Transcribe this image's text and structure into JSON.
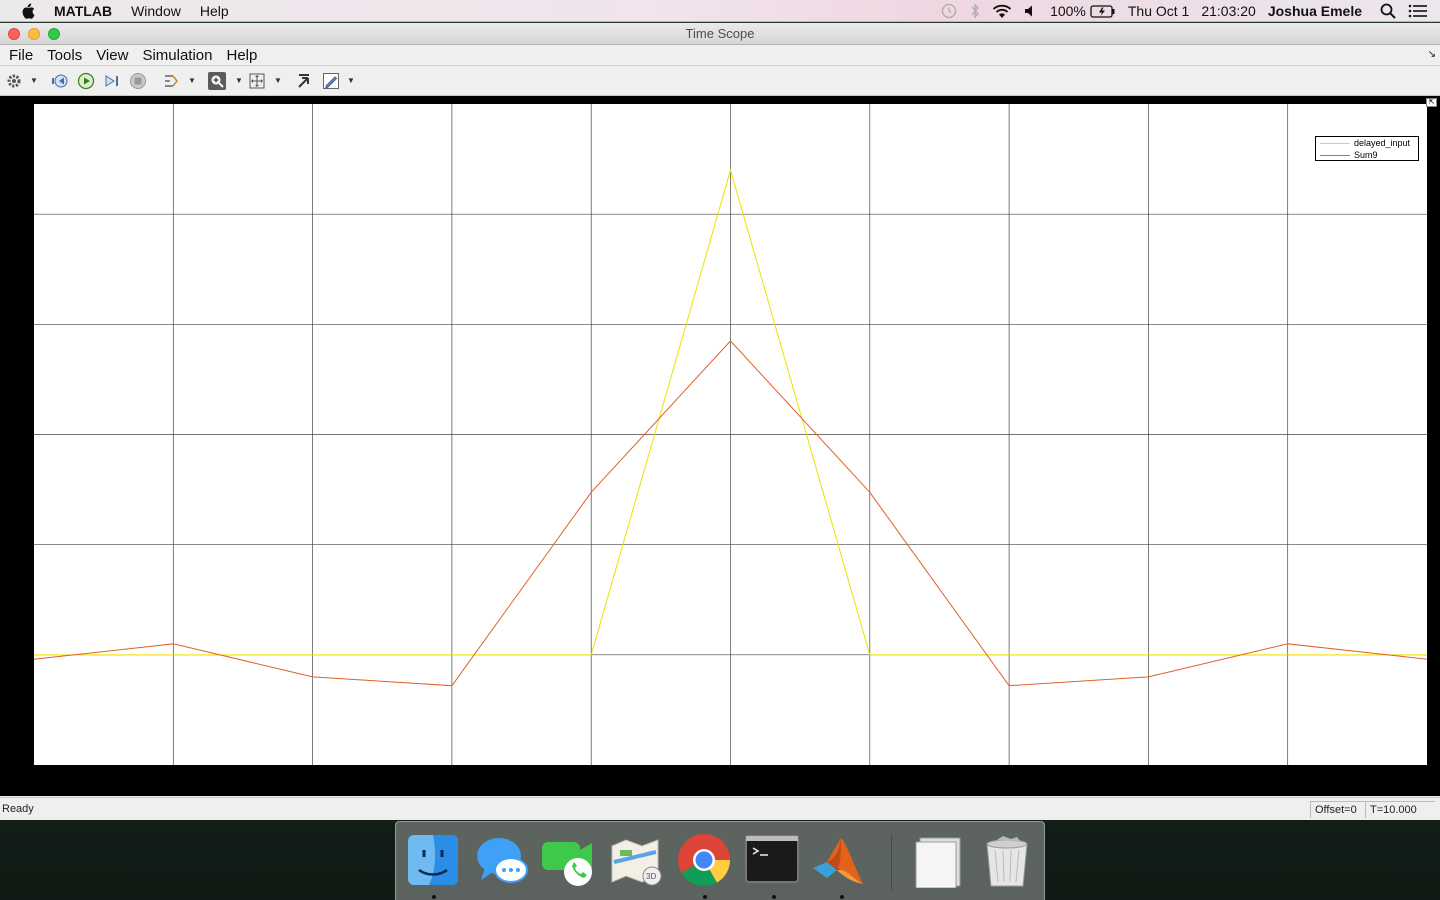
{
  "menubar": {
    "app_name": "MATLAB",
    "items": [
      "Window",
      "Help"
    ],
    "battery": "100%",
    "date": "Thu Oct 1",
    "time": "21:03:20",
    "user": "Joshua Emele"
  },
  "window": {
    "title": "Time Scope",
    "menus": [
      "File",
      "Tools",
      "View",
      "Simulation",
      "Help"
    ],
    "toolbar_icons": [
      "settings-icon",
      "step-back-icon",
      "run-icon",
      "step-forward-icon",
      "stop-icon",
      "signal-select-icon",
      "zoom-in-icon",
      "zoom-fit-icon",
      "autoscale-icon",
      "cursor-measure-icon"
    ]
  },
  "status": {
    "left": "Ready",
    "offset": "Offset=0",
    "time": "T=10.000"
  },
  "colors": {
    "plot_background": "#ffffff",
    "frame": "#000000",
    "grid": "#444444",
    "series_yellow": "#f0e000",
    "series_orange": "#e0612a"
  },
  "chart_data": {
    "type": "line",
    "title": "",
    "xlabel": "",
    "ylabel": "",
    "xlim": [
      0,
      10
    ],
    "ylim": [
      -0.2,
      1.0
    ],
    "grid": true,
    "legend_position": "top-right",
    "x": [
      0,
      1,
      2,
      3,
      4,
      5,
      6,
      7,
      8,
      9,
      10
    ],
    "series": [
      {
        "name": "delayed_input",
        "color": "#f0e000",
        "values": [
          0,
          0,
          0,
          0,
          0,
          0.88,
          0,
          0,
          0,
          0,
          0
        ]
      },
      {
        "name": "Sum9",
        "color": "#e0612a",
        "values": [
          -0.008,
          0.02,
          -0.04,
          -0.056,
          0.295,
          0.57,
          0.295,
          -0.056,
          -0.04,
          0.02,
          -0.008
        ]
      }
    ]
  },
  "dock": {
    "apps": [
      "finder-icon",
      "messages-icon",
      "facetime-icon",
      "maps-icon",
      "chrome-icon",
      "terminal-icon",
      "matlab-icon",
      "documents-stack-icon",
      "trash-icon"
    ]
  }
}
